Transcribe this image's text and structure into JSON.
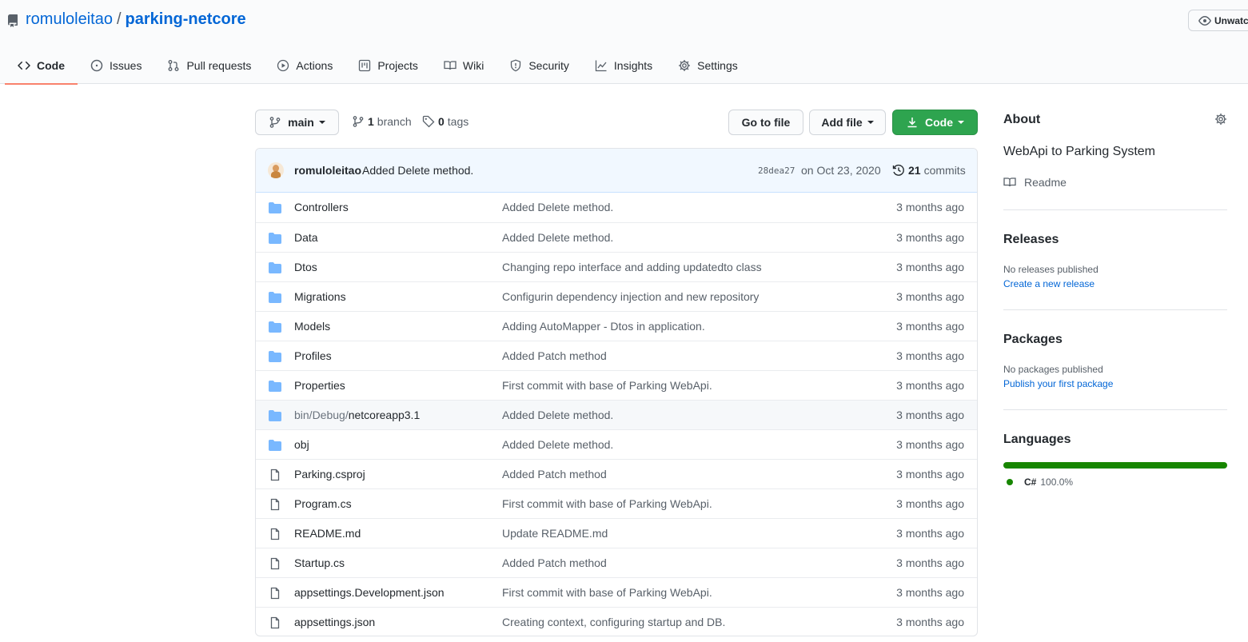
{
  "repo": {
    "owner": "romuloleitao",
    "name": "parking-netcore",
    "separator": "/",
    "unwatch_label": "Unwatch"
  },
  "tabs": [
    {
      "label": "Code",
      "icon": "code-icon",
      "selected": true
    },
    {
      "label": "Issues",
      "icon": "issue-icon"
    },
    {
      "label": "Pull requests",
      "icon": "pull-request-icon"
    },
    {
      "label": "Actions",
      "icon": "play-icon"
    },
    {
      "label": "Projects",
      "icon": "project-icon"
    },
    {
      "label": "Wiki",
      "icon": "book-icon"
    },
    {
      "label": "Security",
      "icon": "shield-icon"
    },
    {
      "label": "Insights",
      "icon": "graph-icon"
    },
    {
      "label": "Settings",
      "icon": "gear-icon"
    }
  ],
  "toolbar": {
    "branch_button": "main",
    "branch_count": "1",
    "branch_word": "branch",
    "tag_count": "0",
    "tag_word": "tags",
    "goto_file": "Go to file",
    "add_file": "Add file",
    "code": "Code"
  },
  "latest_commit": {
    "author": "romuloleitao",
    "message": "Added Delete method.",
    "sha": "28dea27",
    "date": "on Oct 23, 2020",
    "commits_count": "21",
    "commits_word": "commits"
  },
  "files": [
    {
      "type": "dir",
      "name": "Controllers",
      "message": "Added Delete method.",
      "age": "3 months ago"
    },
    {
      "type": "dir",
      "name": "Data",
      "message": "Added Delete method.",
      "age": "3 months ago"
    },
    {
      "type": "dir",
      "name": "Dtos",
      "message": "Changing repo interface and adding updatedto class",
      "age": "3 months ago"
    },
    {
      "type": "dir",
      "name": "Migrations",
      "message": "Configurin dependency injection and new repository",
      "age": "3 months ago"
    },
    {
      "type": "dir",
      "name": "Models",
      "message": "Adding AutoMapper - Dtos in application.",
      "age": "3 months ago"
    },
    {
      "type": "dir",
      "name": "Profiles",
      "message": "Added Patch method",
      "age": "3 months ago"
    },
    {
      "type": "dir",
      "name": "Properties",
      "message": "First commit with base of Parking WebApi.",
      "age": "3 months ago"
    },
    {
      "type": "dir",
      "name_prefix": "bin/Debug/",
      "name": "netcoreapp3.1",
      "message": "Added Delete method.",
      "age": "3 months ago",
      "hover": true
    },
    {
      "type": "dir",
      "name": "obj",
      "message": "Added Delete method.",
      "age": "3 months ago"
    },
    {
      "type": "file",
      "name": "Parking.csproj",
      "message": "Added Patch method",
      "age": "3 months ago"
    },
    {
      "type": "file",
      "name": "Program.cs",
      "message": "First commit with base of Parking WebApi.",
      "age": "3 months ago"
    },
    {
      "type": "file",
      "name": "README.md",
      "message": "Update README.md",
      "age": "3 months ago"
    },
    {
      "type": "file",
      "name": "Startup.cs",
      "message": "Added Patch method",
      "age": "3 months ago"
    },
    {
      "type": "file",
      "name": "appsettings.Development.json",
      "message": "First commit with base of Parking WebApi.",
      "age": "3 months ago"
    },
    {
      "type": "file",
      "name": "appsettings.json",
      "message": "Creating context, configuring startup and DB.",
      "age": "3 months ago"
    }
  ],
  "sidebar": {
    "about_heading": "About",
    "description": "WebApi to Parking System",
    "readme_label": "Readme",
    "releases_heading": "Releases",
    "releases_none": "No releases published",
    "releases_link": "Create a new release",
    "packages_heading": "Packages",
    "packages_none": "No packages published",
    "packages_link": "Publish your first package",
    "languages_heading": "Languages",
    "languages": [
      {
        "name": "C#",
        "percent": "100.0%",
        "color": "#178600",
        "fraction": 1.0
      }
    ]
  },
  "colors": {
    "link": "#0366d6",
    "primary_button": "#2ea44f",
    "tab_underline": "#f9826c",
    "folder": "#79b8ff"
  }
}
